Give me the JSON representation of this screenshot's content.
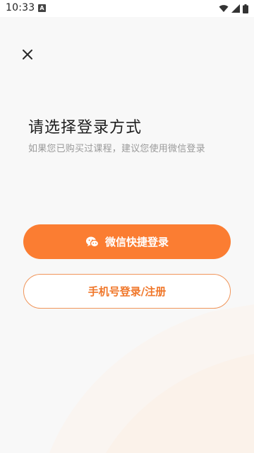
{
  "status_bar": {
    "time": "10:33",
    "app_badge": "A",
    "icons": [
      "wifi-icon",
      "signal-icon",
      "battery-icon"
    ]
  },
  "close_icon": "close-icon",
  "title": "请选择登录方式",
  "subtitle": "如果您已购买过课程，建议您使用微信登录",
  "wechat_button": {
    "label": "微信快捷登录",
    "icon": "wechat-icon"
  },
  "phone_button": {
    "label": "手机号登录/注册"
  },
  "colors": {
    "accent": "#fb7d32",
    "outline": "#f0955a",
    "background": "#f8f8f8"
  }
}
